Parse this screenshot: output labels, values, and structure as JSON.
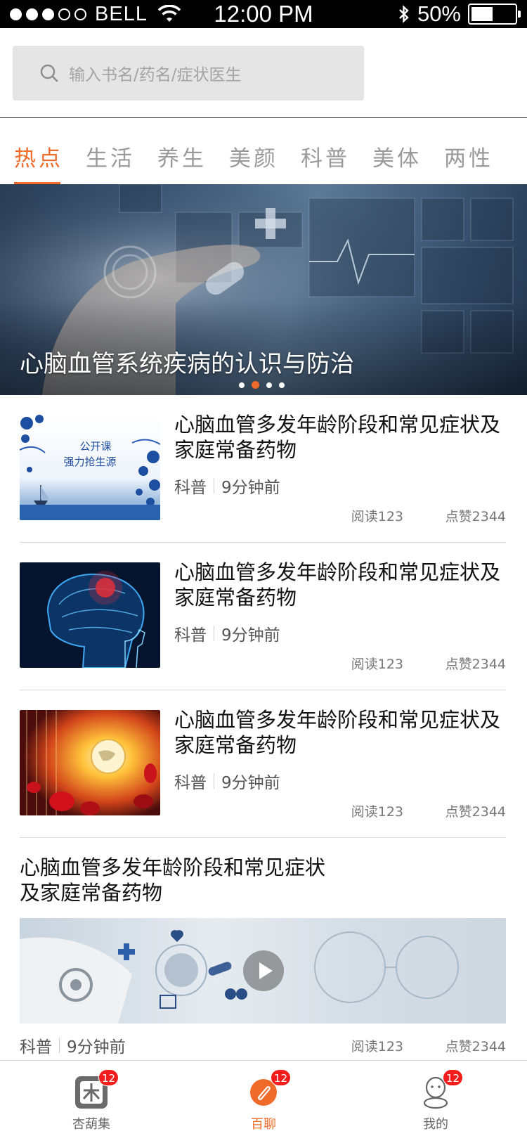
{
  "status_bar": {
    "carrier": "BELL",
    "time": "12:00 PM",
    "battery_percent": "50%",
    "battery_level": 0.5,
    "signal_dots_filled": 3,
    "signal_dots_total": 5
  },
  "search": {
    "placeholder": "输入书名/药名/症状医生"
  },
  "tabs": [
    {
      "label": "热点",
      "active": true
    },
    {
      "label": "生活",
      "active": false
    },
    {
      "label": "养生",
      "active": false
    },
    {
      "label": "美颜",
      "active": false
    },
    {
      "label": "科普",
      "active": false
    },
    {
      "label": "美体",
      "active": false
    },
    {
      "label": "两性",
      "active": false
    }
  ],
  "banner": {
    "title": "心脑血管系统疾病的认识与防治",
    "slide_count": 4,
    "active_slide": 2
  },
  "articles": [
    {
      "title": "心脑血管多发年龄阶段和常见症状及家庭常备药物",
      "category": "科普",
      "time": "9分钟前",
      "reads": "阅读123",
      "likes": "点赞2344",
      "thumb_text": [
        "公开课",
        "强力抢生源"
      ]
    },
    {
      "title": "心脑血管多发年龄阶段和常见症状及家庭常备药物",
      "category": "科普",
      "time": "9分钟前",
      "reads": "阅读123",
      "likes": "点赞2344"
    },
    {
      "title": "心脑血管多发年龄阶段和常见症状及家庭常备药物",
      "category": "科普",
      "time": "9分钟前",
      "reads": "阅读123",
      "likes": "点赞2344"
    }
  ],
  "video_article": {
    "title": "心脑血管多发年龄阶段和常见症状及家庭常备药物",
    "category": "科普",
    "time": "9分钟前",
    "reads": "阅读123",
    "likes": "点赞2344"
  },
  "tab_bar": [
    {
      "label": "杏葫集",
      "badge": "12",
      "icon": "xinghuji-icon",
      "active": false
    },
    {
      "label": "百聊",
      "badge": "12",
      "icon": "chat-icon",
      "active": true
    },
    {
      "label": "我的",
      "badge": "12",
      "icon": "profile-icon",
      "active": false
    }
  ],
  "colors": {
    "accent": "#f06a2a",
    "badge": "#f21c1c",
    "status_bar_bg": "#000000"
  }
}
